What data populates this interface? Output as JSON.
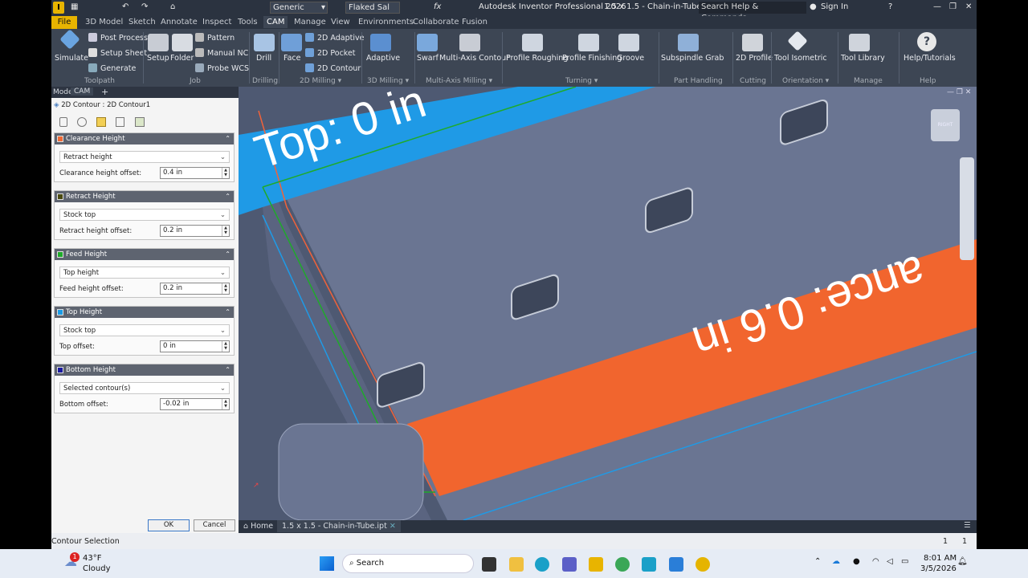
{
  "app": {
    "title": "Autodesk Inventor Professional 2026",
    "document": "1.5 x 1.5 - Chain-in-Tube",
    "search_placeholder": "Search Help & Commands...",
    "sign_in": "Sign In",
    "material": "Generic",
    "appearance": "Flaked Sal",
    "fx": "fx"
  },
  "menu": [
    "File",
    "3D Model",
    "Sketch",
    "Annotate",
    "Inspect",
    "Tools",
    "CAM",
    "Manage",
    "View",
    "Environments",
    "Collaborate",
    "Fusion"
  ],
  "ribbon": {
    "simulate": "Simulate",
    "post_process": "Post Process",
    "setup_sheet": "Setup Sheet",
    "generate": "Generate",
    "setup": "Setup",
    "folder": "Folder",
    "pattern": "Pattern",
    "manual_nc": "Manual NC",
    "probe_wcs": "Probe WCS",
    "drill": "Drill",
    "face": "Face",
    "adaptive2d": "2D Adaptive",
    "pocket2d": "2D Pocket",
    "contour2d": "2D Contour",
    "adaptive": "Adaptive",
    "swarf": "Swarf",
    "multi_axis": "Multi-Axis Contour",
    "profile_roughing": "Profile Roughing",
    "profile_finishing": "Profile Finishing",
    "groove": "Groove",
    "subspindle_grab": "Subspindle Grab",
    "profile2d": "2D Profile",
    "tool_isometric": "Tool Isometric",
    "tool_library": "Tool Library",
    "help": "Help/Tutorials",
    "groups": {
      "toolpath": "Toolpath",
      "job": "Job",
      "drilling": "Drilling",
      "milling2d": "2D Milling",
      "milling3d": "3D Milling",
      "multiaxis": "Multi-Axis Milling",
      "turning": "Turning",
      "part_handling": "Part Handling",
      "cutting": "Cutting",
      "orientation": "Orientation",
      "manage": "Manage",
      "help": "Help"
    }
  },
  "browser_tabs": {
    "model": "Model",
    "cam": "CAM",
    "plus": "+"
  },
  "panel": {
    "title": "2D Contour : 2D Contour1",
    "sections": [
      {
        "header": "Clearance Height",
        "color": "#f06a35",
        "mode": "Retract height",
        "offset_label": "Clearance height offset:",
        "offset": "0.4 in"
      },
      {
        "header": "Retract Height",
        "color": "#4a4a10",
        "mode": "Stock top",
        "offset_label": "Retract height offset:",
        "offset": "0.2 in"
      },
      {
        "header": "Feed Height",
        "color": "#1faa2a",
        "mode": "Top height",
        "offset_label": "Feed height offset:",
        "offset": "0.2 in"
      },
      {
        "header": "Top Height",
        "color": "#1a9be6",
        "mode": "Stock top",
        "offset_label": "Top offset:",
        "offset": "0 in"
      },
      {
        "header": "Bottom Height",
        "color": "#1a1aa0",
        "mode": "Selected contour(s)",
        "offset_label": "Bottom offset:",
        "offset": "-0.02 in"
      }
    ],
    "ok": "OK",
    "cancel": "Cancel"
  },
  "viewport": {
    "top_label": "Top: 0 in",
    "clearance_label": "ance: 0.6 in",
    "viewcube": "RIGHT"
  },
  "doc_tabs": {
    "home": "Home",
    "file": "1.5 x 1.5 - Chain-in-Tube.ipt"
  },
  "status": {
    "text": "Contour Selection",
    "count1": "1",
    "count2": "1"
  },
  "taskbar": {
    "temp": "43°F",
    "weather": "Cloudy",
    "search": "Search",
    "time": "8:01 AM",
    "date": "3/5/2026",
    "badge": "1"
  }
}
